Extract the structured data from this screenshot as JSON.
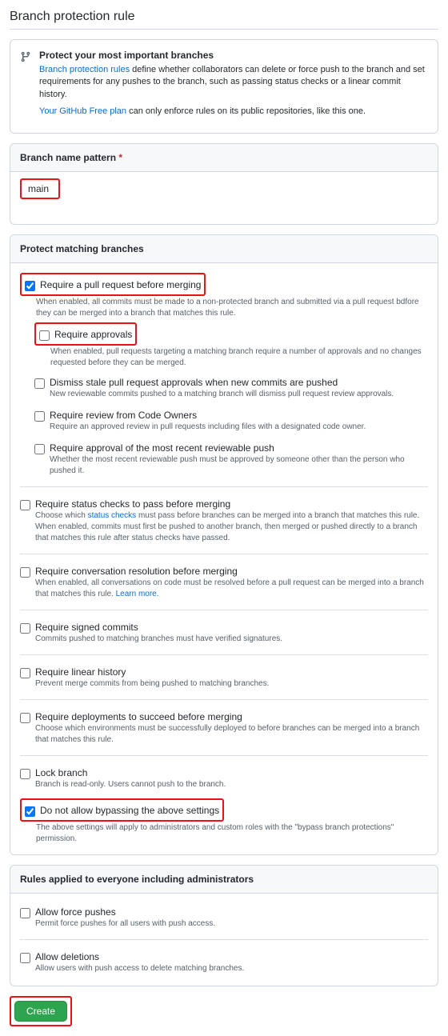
{
  "title": "Branch protection rule",
  "info": {
    "heading": "Protect your most important branches",
    "link1": "Branch protection rules",
    "text1": " define whether collaborators can delete or force push to the branch and set requirements for any pushes to the branch, such as passing status checks or a linear commit history.",
    "link2": "Your GitHub Free plan",
    "text2": " can only enforce rules on its public repositories, like this one."
  },
  "pattern": {
    "label": "Branch name pattern",
    "asterisk": "*",
    "value": "main"
  },
  "protect_header": "Protect matching branches",
  "rules": {
    "pr": {
      "label": "Require a pull request before merging",
      "desc": "When enabled, all commits must be made to a non-protected branch and submitted via a pull request bdfore they can be merged into a branch that matches this rule.",
      "sub": {
        "approvals": {
          "label": "Require approvals",
          "desc": "When enabled, pull requests targeting a matching branch require a number of approvals and no changes requested before they can be merged."
        },
        "dismiss": {
          "label": "Dismiss stale pull request approvals when new commits are pushed",
          "desc": "New reviewable commits pushed to a matching branch will dismiss pull request review approvals."
        },
        "codeowners": {
          "label": "Require review from Code Owners",
          "desc": "Require an approved review in pull requests including files with a designated code owner."
        },
        "lastpush": {
          "label": "Require approval of the most recent reviewable push",
          "desc": "Whether the most recent reviewable push must be approved by someone other than the person who pushed it."
        }
      }
    },
    "status": {
      "label": "Require status checks to pass before merging",
      "desc_pre": "Choose which ",
      "desc_link": "status checks",
      "desc_post": " must pass before branches can be merged into a branch that matches this rule. When enabled, commits must first be pushed to another branch, then merged or pushed directly to a branch that matches this rule after status checks have passed."
    },
    "conversation": {
      "label": "Require conversation resolution before merging",
      "desc": "When enabled, all conversations on code must be resolved before a pull request can be merged into a branch that matches this rule. ",
      "learn": "Learn more."
    },
    "signed": {
      "label": "Require signed commits",
      "desc": "Commits pushed to matching branches must have verified signatures."
    },
    "linear": {
      "label": "Require linear history",
      "desc": "Prevent merge commits from being pushed to matching branches."
    },
    "deployments": {
      "label": "Require deployments to succeed before merging",
      "desc": "Choose which environments must be successfully deployed to before branches can be merged into a branch that matches this rule."
    },
    "lock": {
      "label": "Lock branch",
      "desc": "Branch is read-only. Users cannot push to the branch."
    },
    "bypass": {
      "label": "Do not allow bypassing the above settings",
      "desc": "The above settings will apply to administrators and custom roles with the \"bypass branch protections\" permission."
    }
  },
  "admin_header": "Rules applied to everyone including administrators",
  "admin": {
    "force": {
      "label": "Allow force pushes",
      "desc": "Permit force pushes for all users with push access."
    },
    "delete": {
      "label": "Allow deletions",
      "desc": "Allow users with push access to delete matching branches."
    }
  },
  "create_btn": "Create"
}
